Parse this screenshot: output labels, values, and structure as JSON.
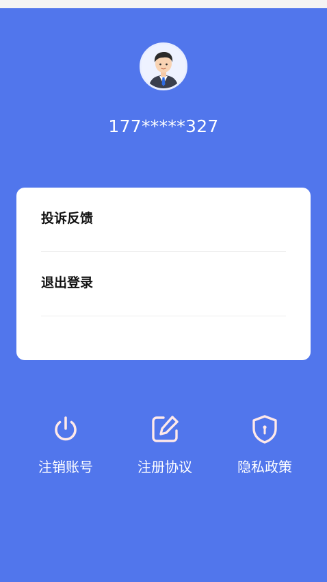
{
  "profile": {
    "phone": "177*****327",
    "avatar_icon": "businessman-avatar-icon"
  },
  "menu": {
    "items": [
      {
        "label": "投诉反馈"
      },
      {
        "label": "退出登录"
      }
    ]
  },
  "actions": [
    {
      "label": "注销账号",
      "icon": "power-icon"
    },
    {
      "label": "注册协议",
      "icon": "edit-document-icon"
    },
    {
      "label": "隐私政策",
      "icon": "shield-lock-icon"
    }
  ],
  "colors": {
    "background": "#5176EC",
    "icon_tint": "#FFE9E9",
    "card": "#FFFFFF"
  }
}
